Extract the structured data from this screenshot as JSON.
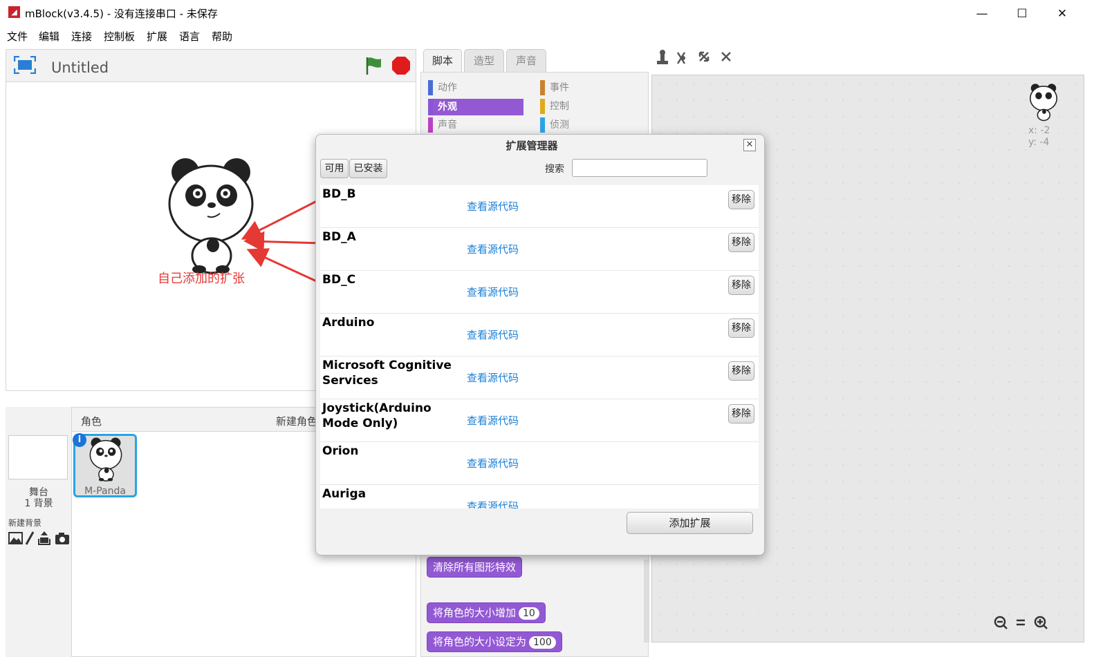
{
  "window": {
    "title": "mBlock(v3.4.5) - 没有连接串口 - 未保存",
    "logo": "mblock-logo",
    "controls": [
      "minimize-icon",
      "maximize-icon",
      "close-icon"
    ],
    "minimize_glyph": "—",
    "maximize_glyph": "☐",
    "close_glyph": "✕"
  },
  "menu": [
    "文件",
    "编辑",
    "连接",
    "控制板",
    "扩展",
    "语言",
    "帮助"
  ],
  "stage": {
    "title": "Untitled",
    "annotation": "自己添加的扩张",
    "annotation_color": "#e53935"
  },
  "sprites": {
    "header_label": "角色",
    "new_sprite_label": "新建角色",
    "stage_name": "舞台",
    "backdrop_count": "1 背景",
    "new_backdrop_label": "新建背景",
    "sprite_name": "M-Panda",
    "info_glyph": "i"
  },
  "tabs": [
    "脚本",
    "造型",
    "声音"
  ],
  "categories_left": [
    {
      "label": "动作",
      "color": "#4a6cd4"
    },
    {
      "label": "外观",
      "color": "#8a55d7",
      "selected": true
    },
    {
      "label": "声音",
      "color": "#bb42c3"
    }
  ],
  "categories_right": [
    {
      "label": "事件",
      "color": "#c88330"
    },
    {
      "label": "控制",
      "color": "#e1a91a"
    },
    {
      "label": "侦测",
      "color": "#2ca5e2"
    }
  ],
  "blocks": {
    "clear_effects": "清除所有图形特效",
    "change_size": "将角色的大小增加",
    "change_size_value": "10",
    "set_size": "将角色的大小设定为",
    "set_size_value": "100"
  },
  "workspace": {
    "x_label": "x: -2",
    "y_label": "y: -4"
  },
  "dialog": {
    "title": "扩展管理器",
    "close_glyph": "✕",
    "filter_available": "可用",
    "filter_installed": "已安装",
    "search_label": "搜索",
    "search_value": "",
    "add_button": "添加扩展",
    "extensions": [
      {
        "name": "BD_B",
        "source_link": "查看源代码",
        "remove": "移除"
      },
      {
        "name": "BD_A",
        "source_link": "查看源代码",
        "remove": "移除"
      },
      {
        "name": "BD_C",
        "source_link": "查看源代码",
        "remove": "移除"
      },
      {
        "name": "Arduino",
        "source_link": "查看源代码",
        "remove": "移除"
      },
      {
        "name": "Microsoft Cognitive Services",
        "source_link": "查看源代码",
        "remove": "移除"
      },
      {
        "name": "Joystick(Arduino Mode Only)",
        "source_link": "查看源代码",
        "remove": "移除"
      },
      {
        "name": "Orion",
        "source_link": "查看源代码",
        "remove": ""
      },
      {
        "name": "Auriga",
        "source_link": "查看源代码",
        "remove": ""
      }
    ]
  },
  "colors": {
    "accent_blue": "#29a3e0",
    "looks_purple": "#9359d4",
    "link_blue": "#1a7fd6",
    "stop_red": "#e01b1b",
    "flag_green": "#3f8f3a"
  }
}
